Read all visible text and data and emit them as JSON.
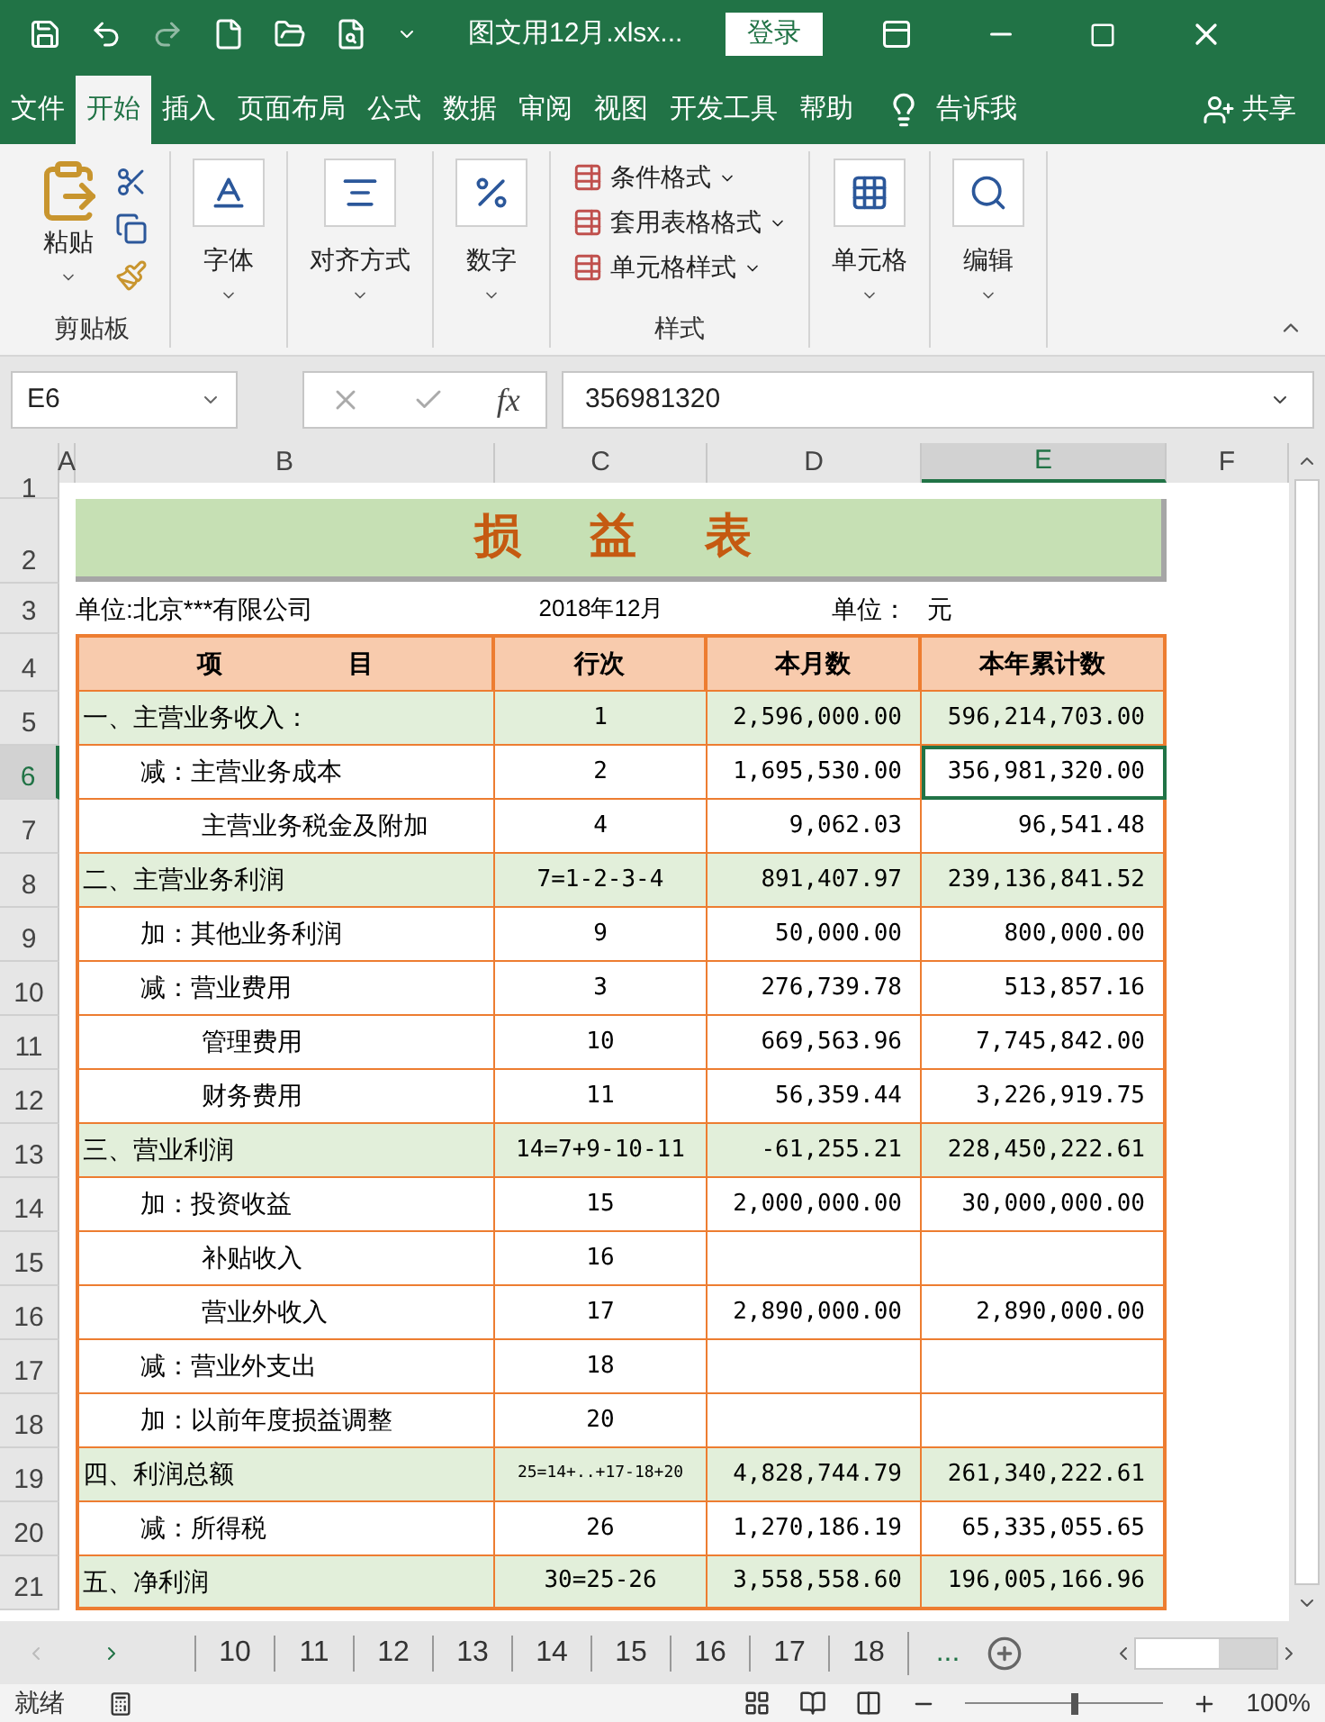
{
  "title_bar": {
    "filename": "图文用12月.xlsx...",
    "login": "登录"
  },
  "ribbon_tabs": [
    {
      "label": "文件",
      "selected": false
    },
    {
      "label": "开始",
      "selected": true
    },
    {
      "label": "插入",
      "selected": false
    },
    {
      "label": "页面布局",
      "selected": false
    },
    {
      "label": "公式",
      "selected": false
    },
    {
      "label": "数据",
      "selected": false
    },
    {
      "label": "审阅",
      "selected": false
    },
    {
      "label": "视图",
      "selected": false
    },
    {
      "label": "开发工具",
      "selected": false
    },
    {
      "label": "帮助",
      "selected": false
    }
  ],
  "tell_me": "告诉我",
  "share": "共享",
  "ribbon_groups": [
    {
      "kind": "clipboard",
      "button": "粘贴",
      "label": "剪贴板"
    },
    {
      "kind": "font",
      "button": "字体"
    },
    {
      "kind": "align",
      "button": "对齐方式"
    },
    {
      "kind": "number",
      "button": "数字"
    },
    {
      "kind": "styles",
      "items": [
        "条件格式",
        "套用表格格式",
        "单元格样式"
      ],
      "label": "样式"
    },
    {
      "kind": "cells",
      "button": "单元格"
    },
    {
      "kind": "edit",
      "button": "编辑"
    }
  ],
  "formula_bar": {
    "name_box": "E6",
    "fx": "fx",
    "value": "356981320"
  },
  "columns": [
    {
      "label": "A",
      "selected": false
    },
    {
      "label": "B",
      "selected": false
    },
    {
      "label": "C",
      "selected": false
    },
    {
      "label": "D",
      "selected": false
    },
    {
      "label": "E",
      "selected": true
    },
    {
      "label": "F",
      "selected": false
    }
  ],
  "row_numbers": [
    {
      "label": "1",
      "selected": false
    },
    {
      "label": "2",
      "selected": false
    },
    {
      "label": "3",
      "selected": false
    },
    {
      "label": "4",
      "selected": false
    }
  ],
  "sheet": {
    "title": "损　益　表",
    "unit_company": "单位:北京***有限公司",
    "period": "2018年12月",
    "unit_label": "单位：",
    "unit_value": "元",
    "headers": [
      "项　　　　　目",
      "行次",
      "本月数",
      "本年累计数"
    ],
    "rows": [
      {
        "num": "5",
        "kind": "section",
        "item": "一、主营业务收入：",
        "line": "1",
        "month": "2,596,000.00",
        "year": "596,214,703.00",
        "selected": false
      },
      {
        "num": "6",
        "kind": "item",
        "item": "减：主营业务成本",
        "line": "2",
        "month": "1,695,530.00",
        "year": "356,981,320.00",
        "selected": true
      },
      {
        "num": "7",
        "kind": "subitem",
        "item": "主营业务税金及附加",
        "line": "4",
        "month": "9,062.03",
        "year": "96,541.48",
        "selected": false
      },
      {
        "num": "8",
        "kind": "section",
        "item": "二、主营业务利润",
        "line": "7=1-2-3-4",
        "month": "891,407.97",
        "year": "239,136,841.52",
        "selected": false
      },
      {
        "num": "9",
        "kind": "item",
        "item": "加：其他业务利润",
        "line": "9",
        "month": "50,000.00",
        "year": "800,000.00",
        "selected": false
      },
      {
        "num": "10",
        "kind": "item",
        "item": "减：营业费用",
        "line": "3",
        "month": "276,739.78",
        "year": "513,857.16",
        "selected": false
      },
      {
        "num": "11",
        "kind": "subitem",
        "item": "管理费用",
        "line": "10",
        "month": "669,563.96",
        "year": "7,745,842.00",
        "selected": false
      },
      {
        "num": "12",
        "kind": "subitem",
        "item": "财务费用",
        "line": "11",
        "month": "56,359.44",
        "year": "3,226,919.75",
        "selected": false
      },
      {
        "num": "13",
        "kind": "section",
        "item": "三、营业利润",
        "line": "14=7+9-10-11",
        "month": "-61,255.21",
        "year": "228,450,222.61",
        "selected": false
      },
      {
        "num": "14",
        "kind": "item",
        "item": "加：投资收益",
        "line": "15",
        "month": "2,000,000.00",
        "year": "30,000,000.00",
        "selected": false
      },
      {
        "num": "15",
        "kind": "subitem",
        "item": "补贴收入",
        "line": "16",
        "selected": false
      },
      {
        "num": "16",
        "kind": "subitem",
        "item": "营业外收入",
        "line": "17",
        "month": "2,890,000.00",
        "year": "2,890,000.00",
        "selected": false
      },
      {
        "num": "17",
        "kind": "item",
        "item": "减：营业外支出",
        "line": "18",
        "selected": false
      },
      {
        "num": "18",
        "kind": "item",
        "item": "加：以前年度损益调整",
        "line": "20",
        "selected": false
      },
      {
        "num": "19",
        "kind": "section",
        "item": "四、利润总额",
        "line": "25=14+..+17-18+20",
        "small_line": true,
        "month": "4,828,744.79",
        "year": "261,340,222.61",
        "selected": false
      },
      {
        "num": "20",
        "kind": "item",
        "item": "减：所得税",
        "line": "26",
        "month": "1,270,186.19",
        "year": "65,335,055.65",
        "selected": false
      },
      {
        "num": "21",
        "kind": "section",
        "item": "五、净利润",
        "line": "30=25-26",
        "month": "3,558,558.60",
        "year": "196,005,166.96",
        "selected": false
      }
    ]
  },
  "sheet_tabs": [
    "10",
    "11",
    "12",
    "13",
    "14",
    "15",
    "16",
    "17",
    "18"
  ],
  "more_tabs": "...",
  "status_bar": {
    "ready": "就绪",
    "zoom": "100%",
    "zoom_level": {
      "level": 0.55
    }
  }
}
